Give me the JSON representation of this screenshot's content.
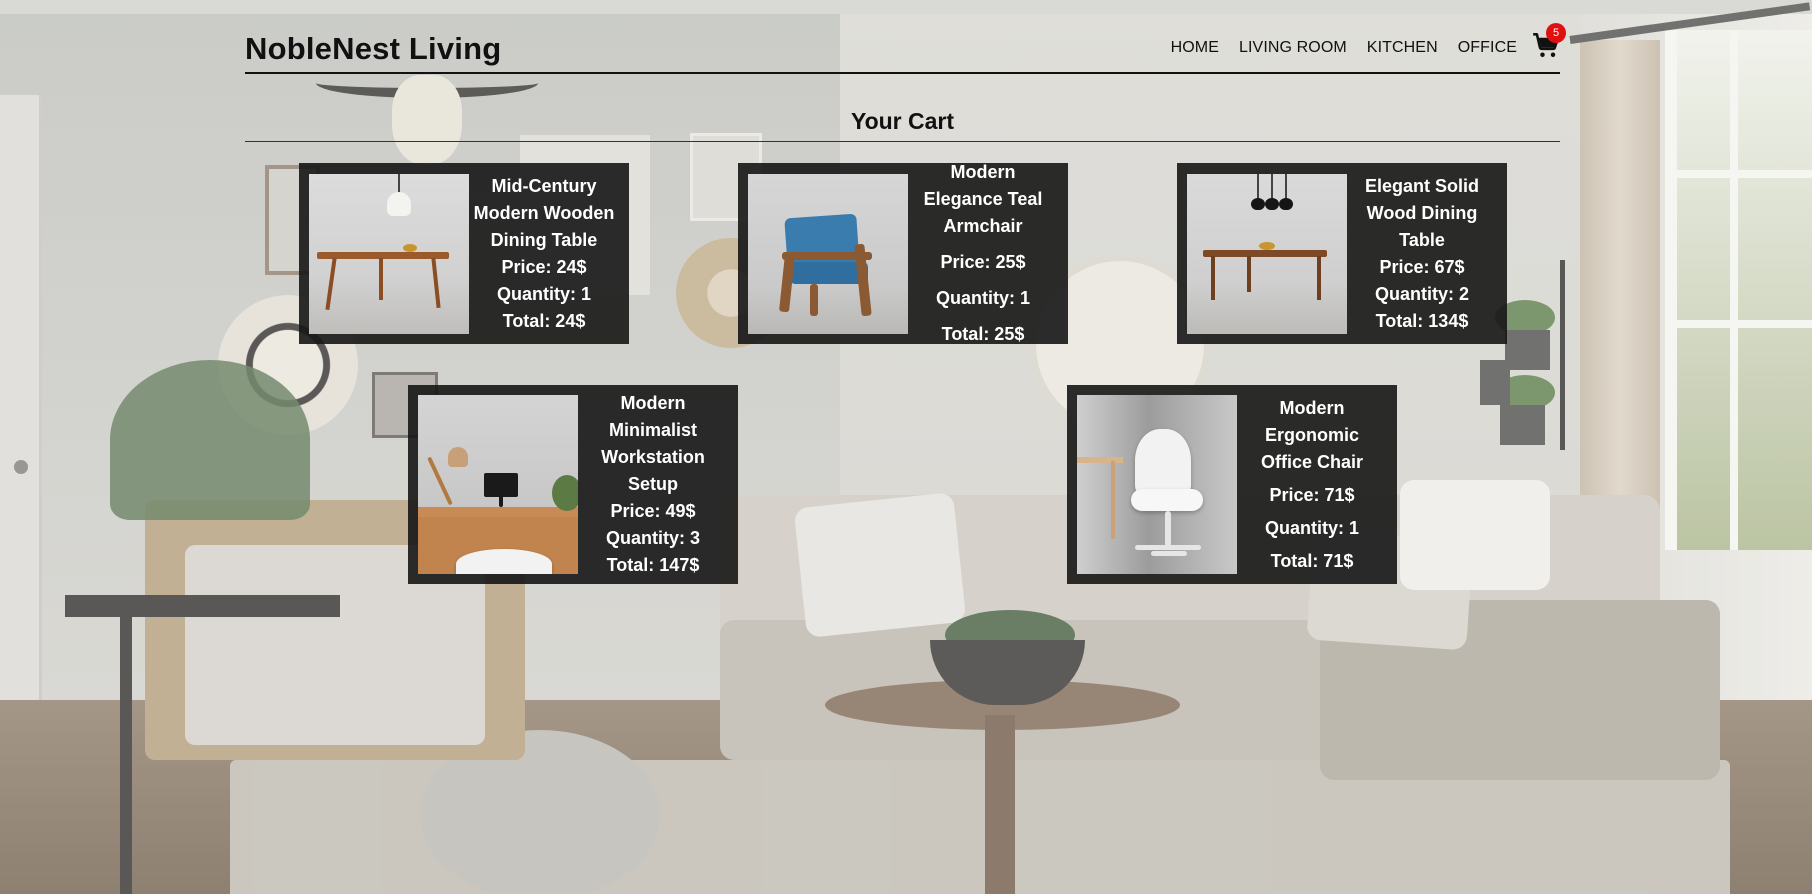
{
  "brand": "NobleNest Living",
  "nav": {
    "home": "HOME",
    "living_room": "LIVING ROOM",
    "kitchen": "KITCHEN",
    "office": "OFFICE"
  },
  "cart": {
    "icon": "shopping-cart-icon",
    "count": "5"
  },
  "page_title": "Your Cart",
  "items": [
    {
      "name": "Mid-Century Modern Wooden Dining Table",
      "price": "Price: 24$",
      "quantity": "Quantity: 1",
      "total": "Total: 24$"
    },
    {
      "name": "Modern Elegance Teal Armchair",
      "price": "Price: 25$",
      "quantity": "Quantity: 1",
      "total": "Total: 25$"
    },
    {
      "name": "Elegant Solid Wood Dining Table",
      "price": "Price: 67$",
      "quantity": "Quantity: 2",
      "total": "Total: 134$"
    },
    {
      "name": "Modern Minimalist Workstation Setup",
      "price": "Price: 49$",
      "quantity": "Quantity: 3",
      "total": "Total: 147$"
    },
    {
      "name": "Modern Ergonomic Office Chair",
      "price": "Price: 71$",
      "quantity": "Quantity: 1",
      "total": "Total: 71$"
    }
  ],
  "colors": {
    "card_bg": "#161616",
    "badge": "#e01010",
    "text_dark": "#111111",
    "text_light": "#ffffff"
  }
}
